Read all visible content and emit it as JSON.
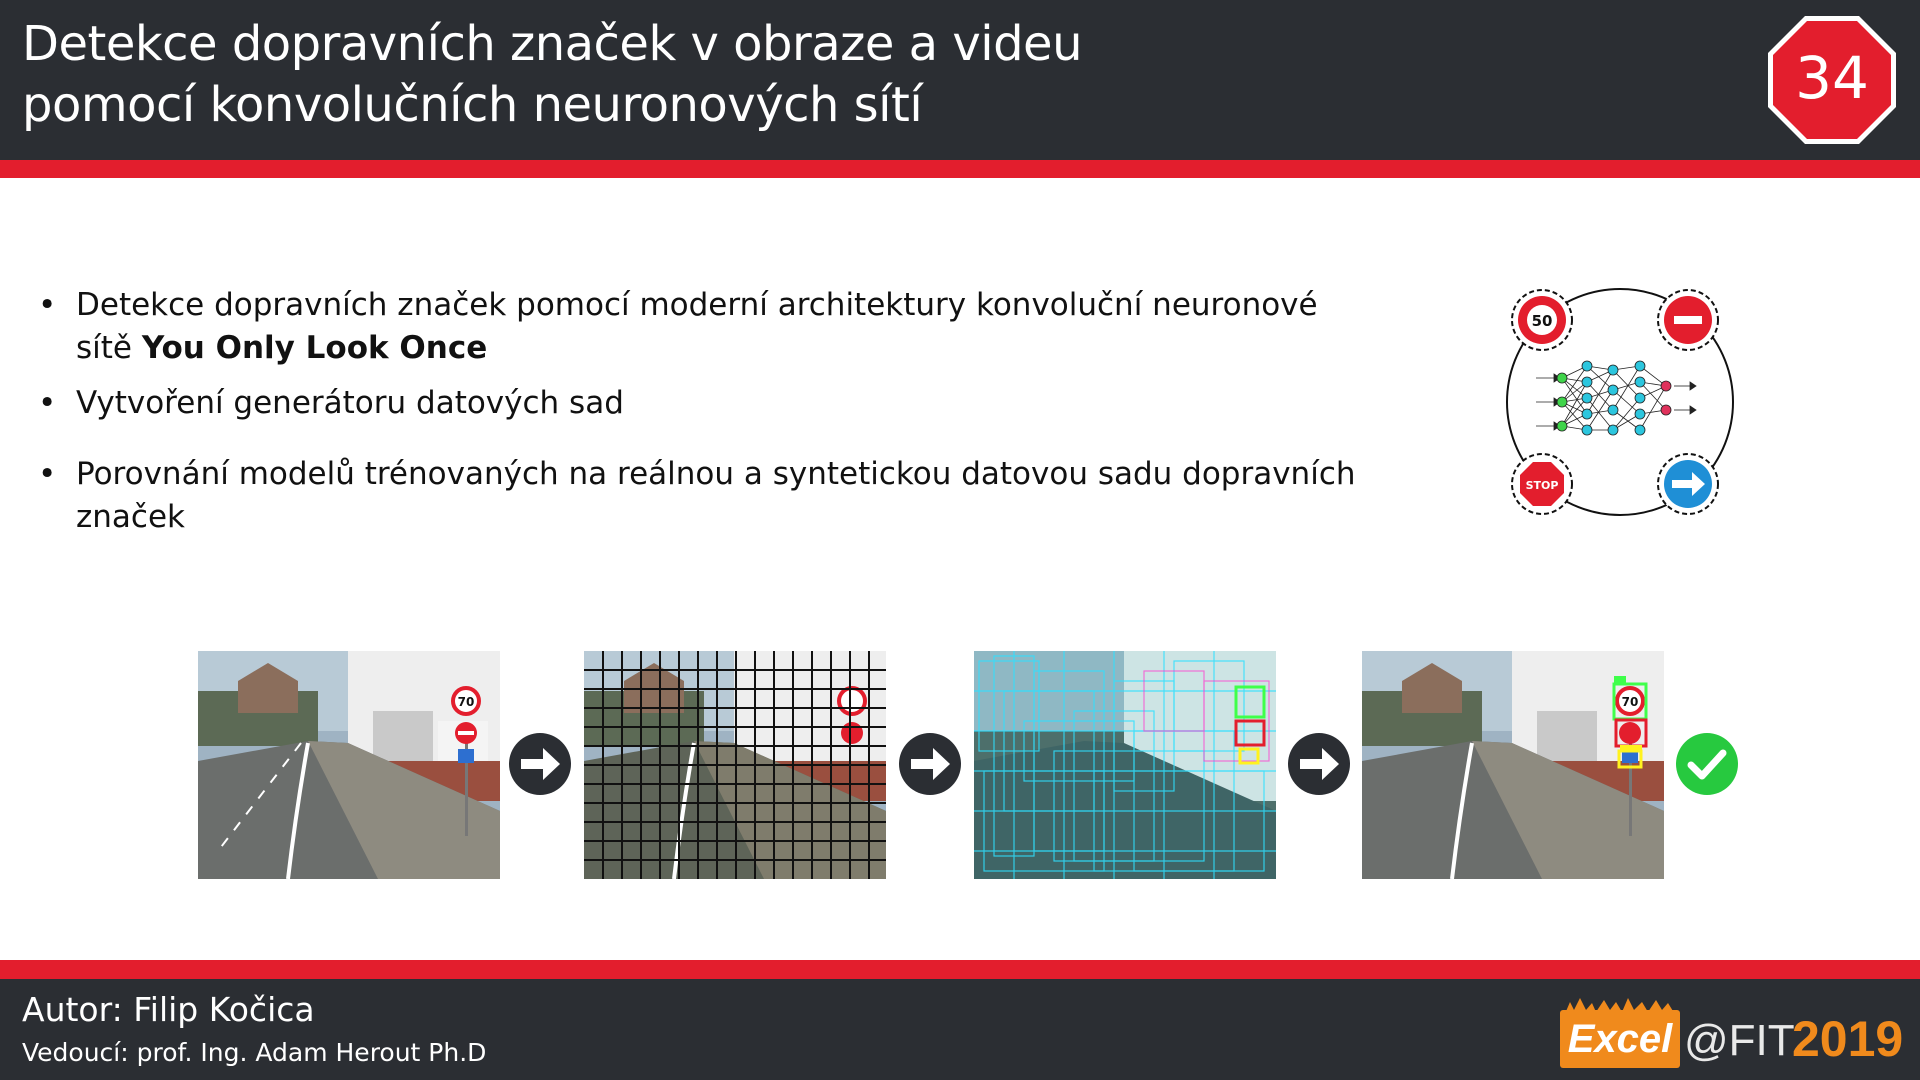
{
  "header": {
    "title_line1": "Detekce dopravních značek v obraze a videu",
    "title_line2": "pomocí konvolučních neuronových sítí",
    "badge_number": "34",
    "badge_color": "#e31e2d",
    "background_color": "#2b2e33",
    "accent_color": "#e31e2d"
  },
  "bullets": [
    {
      "text_before": "Detekce dopravních značek pomocí moderní architektury konvoluční neuronové sítě ",
      "bold": "You Only Look Once"
    },
    {
      "text": "Vytvoření generátoru datových sad"
    },
    {
      "text": "Porovnání modelů trénovaných na reálnou a syntetickou datovou sadu dopravních značek"
    }
  ],
  "diagram": {
    "sign_speed_label": "50",
    "sign_stop_label": "STOP",
    "icons": [
      "speed-limit-sign-icon",
      "no-entry-sign-icon",
      "stop-sign-icon",
      "direction-arrow-sign-icon",
      "neural-network-icon"
    ]
  },
  "pipeline": {
    "steps": [
      "input-image",
      "grid-image",
      "detections-image",
      "result-image"
    ],
    "sign_speed_label": "70",
    "connector_icon": "right-arrow-icon",
    "final_icon": "check-icon",
    "check_color": "#27c93f"
  },
  "footer": {
    "author": "Autor: Filip Kočica",
    "advisor": "Vedoucí: prof. Ing. Adam Herout Ph.D",
    "logo_excel": "Excel",
    "logo_at_fit": "@FIT",
    "logo_year": "2019",
    "logo_color": "#f08a1c"
  }
}
